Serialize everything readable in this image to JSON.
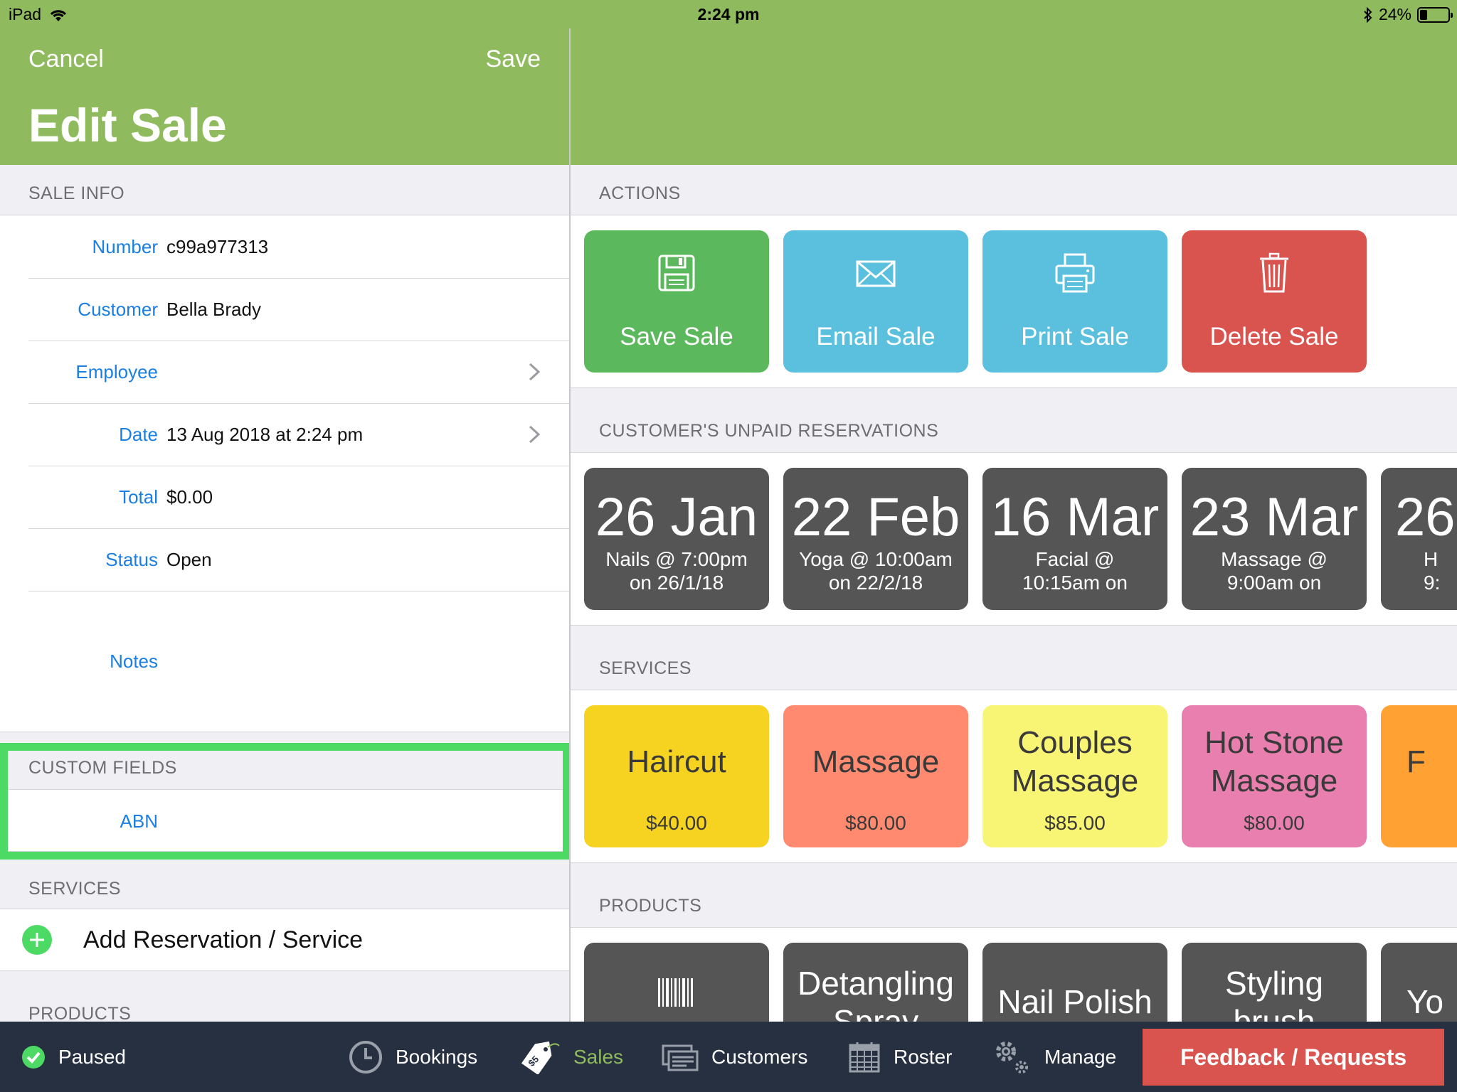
{
  "status_bar": {
    "device": "iPad",
    "time": "2:24 pm",
    "battery_text": "24%",
    "battery_level": 0.24
  },
  "nav": {
    "cancel": "Cancel",
    "save": "Save",
    "title": "Edit Sale"
  },
  "sale_info": {
    "header": "SALE INFO",
    "rows": [
      {
        "label": "Number",
        "value": "c99a977313"
      },
      {
        "label": "Customer",
        "value": "Bella Brady"
      },
      {
        "label": "Employee",
        "value": ""
      },
      {
        "label": "Date",
        "value": "13 Aug 2018 at 2:24 pm"
      },
      {
        "label": "Total",
        "value": "$0.00"
      },
      {
        "label": "Status",
        "value": "Open"
      },
      {
        "label": "Notes",
        "value": ""
      }
    ]
  },
  "custom_fields": {
    "header": "CUSTOM FIELDS",
    "abn_label": "ABN",
    "abn_value": ""
  },
  "services_left": {
    "header": "SERVICES",
    "add_label": "Add Reservation / Service"
  },
  "products_left": {
    "header": "PRODUCTS"
  },
  "actions": {
    "header": "ACTIONS",
    "items": [
      {
        "label": "Save Sale",
        "icon": "floppy-disk-icon",
        "color": "#5cb85c"
      },
      {
        "label": "Email Sale",
        "icon": "envelope-icon",
        "color": "#5bc0de"
      },
      {
        "label": "Print Sale",
        "icon": "printer-icon",
        "color": "#5bc0de"
      },
      {
        "label": "Delete Sale",
        "icon": "trash-icon",
        "color": "#d9534f"
      }
    ]
  },
  "reservations": {
    "header": "CUSTOMER'S UNPAID RESERVATIONS",
    "items": [
      {
        "date": "26 Jan",
        "line1": "Nails @ 7:00pm",
        "line2": "on 26/1/18"
      },
      {
        "date": "22 Feb",
        "line1": "Yoga @ 10:00am",
        "line2": "on 22/2/18"
      },
      {
        "date": "16 Mar",
        "line1": "Facial @",
        "line2": "10:15am on"
      },
      {
        "date": "23 Mar",
        "line1": "Massage @",
        "line2": "9:00am on"
      },
      {
        "date": "26",
        "line1": "H",
        "line2": "9:"
      }
    ]
  },
  "services": {
    "header": "SERVICES",
    "items": [
      {
        "name": "Haircut",
        "price": "$40.00",
        "color": "#f5d320"
      },
      {
        "name": "Massage",
        "price": "$80.00",
        "color": "#ff8a70"
      },
      {
        "name": "Couples Massage",
        "price": "$85.00",
        "color": "#f8f474"
      },
      {
        "name": "Hot Stone Massage",
        "price": "$80.00",
        "color": "#e87fae"
      },
      {
        "name": "F",
        "price": "",
        "color": "#ffa133"
      }
    ]
  },
  "products": {
    "header": "PRODUCTS",
    "items": [
      {
        "name": "",
        "icon": "barcode-icon"
      },
      {
        "name": "Detangling Spray"
      },
      {
        "name": "Nail Polish"
      },
      {
        "name": "Styling brush"
      },
      {
        "name": "Yo"
      }
    ]
  },
  "tabbar": {
    "paused": "Paused",
    "tabs": [
      {
        "label": "Bookings",
        "icon": "clock-icon"
      },
      {
        "label": "Sales",
        "icon": "price-tag-icon",
        "active": true
      },
      {
        "label": "Customers",
        "icon": "cards-icon"
      },
      {
        "label": "Roster",
        "icon": "calendar-icon"
      },
      {
        "label": "Manage",
        "icon": "gears-icon"
      }
    ],
    "feedback": "Feedback / Requests"
  }
}
